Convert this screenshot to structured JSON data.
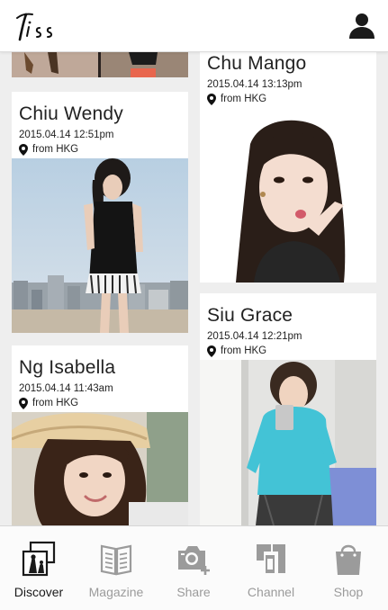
{
  "header": {
    "logo_icon": "kiss-logo",
    "profile_icon": "person-icon"
  },
  "feed": {
    "left": [
      {
        "name": "Chiu Wendy",
        "date": "2015.04.14 12:51pm",
        "location": "from HKG"
      },
      {
        "name": "Ng Isabella",
        "date": "2015.04.14 11:43am",
        "location": "from HKG"
      }
    ],
    "right": [
      {
        "name": "Chu Mango",
        "date": "2015.04.14 13:13pm",
        "location": "from HKG"
      },
      {
        "name": "Siu Grace",
        "date": "2015.04.14 12:21pm",
        "location": "from HKG"
      }
    ]
  },
  "nav": {
    "items": [
      {
        "label": "Discover",
        "icon": "photo-frames-icon",
        "active": true
      },
      {
        "label": "Magazine",
        "icon": "open-book-icon",
        "active": false
      },
      {
        "label": "Share",
        "icon": "camera-add-icon",
        "active": false
      },
      {
        "label": "Channel",
        "icon": "channel-icon",
        "active": false
      },
      {
        "label": "Shop",
        "icon": "shopping-bag-icon",
        "active": false
      }
    ]
  },
  "colors": {
    "header_bg": "#ffffff",
    "feed_bg": "#eeeeee",
    "card_bg": "#ffffff",
    "nav_active": "#1a1a1a",
    "nav_inactive": "#9b9b9b"
  }
}
